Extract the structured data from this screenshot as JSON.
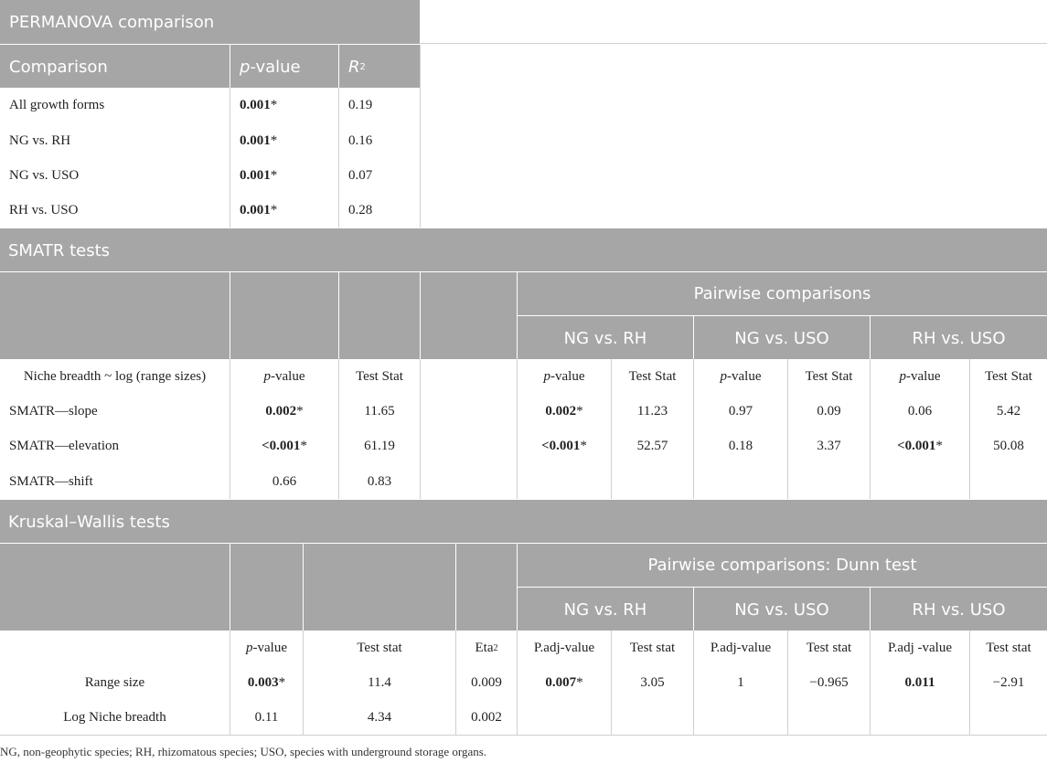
{
  "permanova": {
    "title": "PERMANOVA comparison",
    "headers": {
      "comparison": "Comparison",
      "p_italic": "p",
      "p_rest": "-value",
      "r": "R",
      "r_sup": "2"
    },
    "rows": [
      {
        "label": "All growth forms",
        "p": "0.001",
        "r2": "0.19"
      },
      {
        "label": "NG vs. RH",
        "p": "0.001",
        "r2": "0.16"
      },
      {
        "label": "NG vs. USO",
        "p": "0.001",
        "r2": "0.07"
      },
      {
        "label": "RH vs. USO",
        "p": "0.001",
        "r2": "0.28"
      }
    ]
  },
  "smatr": {
    "title": "SMATR tests",
    "pairwise_title": "Pairwise comparisons",
    "groups": [
      "NG vs. RH",
      "NG vs. USO",
      "RH vs. USO"
    ],
    "subheader": {
      "label": "Niche breadth ~ log (range sizes)",
      "p_italic": "p",
      "p_rest": "-value",
      "stat": "Test Stat"
    },
    "rows": [
      {
        "label": "SMATR—slope",
        "p": "0.002",
        "stat": "11.65",
        "p1": "0.002",
        "s1": "11.23",
        "p2": "0.97",
        "s2": "0.09",
        "p3": "0.06",
        "s3": "5.42"
      },
      {
        "label": "SMATR—elevation",
        "p": "<0.001",
        "stat": "61.19",
        "p1": "<0.001",
        "s1": "52.57",
        "p2": "0.18",
        "s2": "3.37",
        "p3": "<0.001",
        "s3": "50.08"
      },
      {
        "label": "SMATR—shift",
        "p": "0.66",
        "stat": "0.83"
      }
    ]
  },
  "kruskal": {
    "title": "Kruskal–Wallis tests",
    "pairwise_title": "Pairwise comparisons: Dunn test",
    "groups": [
      "NG vs. RH",
      "NG vs. USO",
      "RH vs. USO"
    ],
    "subheader": {
      "p_italic": "p",
      "p_rest": "-value",
      "stat": "Test stat",
      "eta": "Eta",
      "eta_sup": "2",
      "padj1": "P.adj-value",
      "padj2": "P.adj-value",
      "padj3": "P.adj -value",
      "tstat": "Test stat"
    },
    "rows": [
      {
        "label": "Range size",
        "p": "0.003",
        "stat": "11.4",
        "eta": "0.009",
        "p1": "0.007",
        "s1": "3.05",
        "p2": "1",
        "s2": "−0.965",
        "p3": "0.011",
        "s3": "−2.91"
      },
      {
        "label": "Log Niche breadth",
        "p": "0.11",
        "stat": "4.34",
        "eta": "0.002"
      }
    ]
  },
  "asterisk": "*",
  "footnote": "NG, non-geophytic species; RH, rhizomatous species; USO, species with underground storage organs."
}
